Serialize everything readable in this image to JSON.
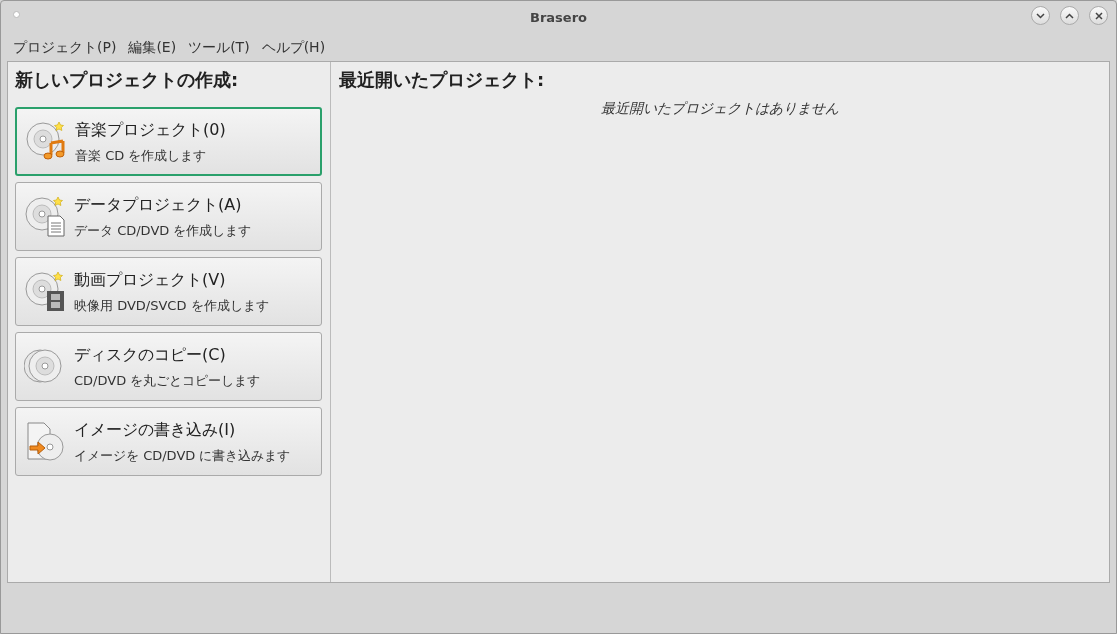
{
  "window": {
    "title": "Brasero"
  },
  "menu": [
    "プロジェクト(P)",
    "編集(E)",
    "ツール(T)",
    "ヘルプ(H)"
  ],
  "new_project": {
    "heading": "新しいプロジェクトの作成:",
    "items": [
      {
        "kind": "audio",
        "title": "音楽プロジェクト(0)",
        "description": "音楽 CD を作成します",
        "selected": true
      },
      {
        "kind": "data",
        "title": "データプロジェクト(A)",
        "description": "データ CD/DVD を作成します",
        "selected": false
      },
      {
        "kind": "video",
        "title": "動画プロジェクト(V)",
        "description": "映像用 DVD/SVCD を作成します",
        "selected": false
      },
      {
        "kind": "copy",
        "title": "ディスクのコピー(C)",
        "description": "CD/DVD を丸ごとコピーします",
        "selected": false
      },
      {
        "kind": "image",
        "title": "イメージの書き込み(I)",
        "description": "イメージを CD/DVD に書き込みます",
        "selected": false
      }
    ]
  },
  "recent": {
    "heading": "最近開いたプロジェクト:",
    "empty_message": "最近開いたプロジェクトはありません"
  }
}
